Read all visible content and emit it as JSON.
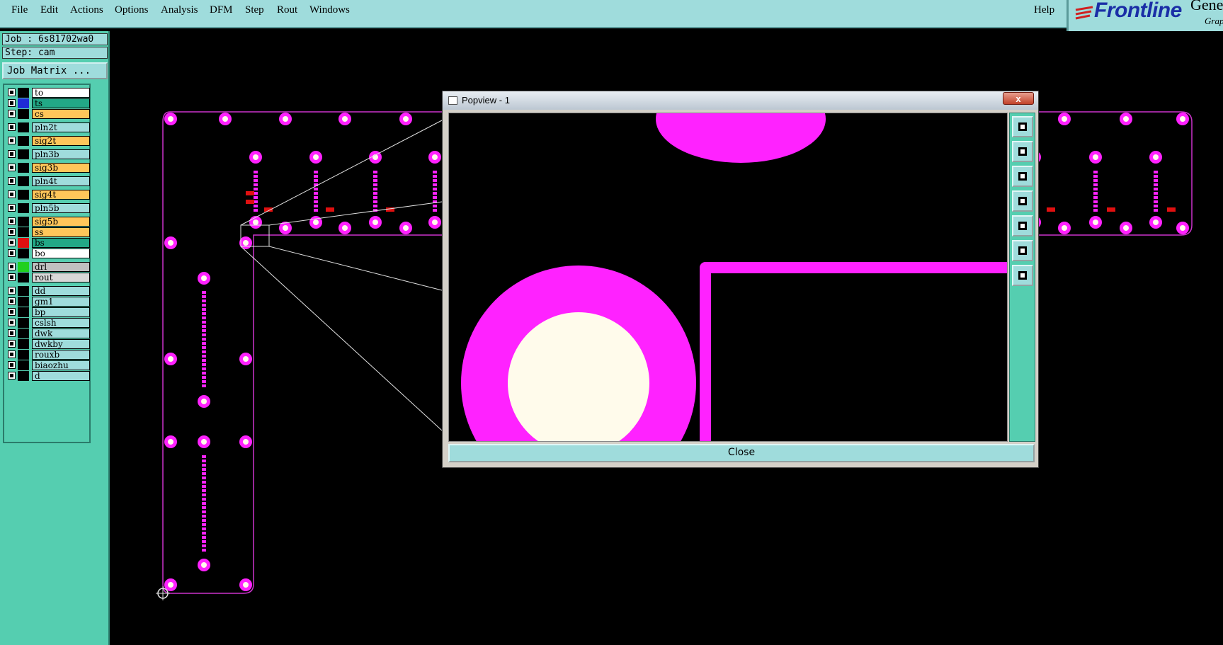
{
  "menu": {
    "items": [
      "File",
      "Edit",
      "Actions",
      "Options",
      "Analysis",
      "DFM",
      "Step",
      "Rout",
      "Windows"
    ],
    "help": "Help"
  },
  "brand": {
    "name": "Frontline",
    "product_fragment": "Gene",
    "sub_fragment": "Grap"
  },
  "job": {
    "job_label": "Job : 6s81702wa0",
    "step_label": "Step: cam",
    "matrix_button": "Job Matrix ..."
  },
  "layers": [
    {
      "name": "to",
      "color": "#000000",
      "name_bg": "#ffffff"
    },
    {
      "name": "ts",
      "color": "#1f2bd6",
      "name_bg": "#22a886"
    },
    {
      "name": "cs",
      "color": "#000000",
      "name_bg": "#ffc65a"
    },
    {
      "name": "pln2t",
      "color": "#000000",
      "name_bg": "#9fdcdc"
    },
    {
      "name": "sig2t",
      "color": "#000000",
      "name_bg": "#ffc65a"
    },
    {
      "name": "pln3b",
      "color": "#000000",
      "name_bg": "#9fdcdc"
    },
    {
      "name": "sig3b",
      "color": "#000000",
      "name_bg": "#ffc65a"
    },
    {
      "name": "pln4t",
      "color": "#000000",
      "name_bg": "#9fdcdc"
    },
    {
      "name": "sig4t",
      "color": "#000000",
      "name_bg": "#ffc65a"
    },
    {
      "name": "pln5b",
      "color": "#000000",
      "name_bg": "#9fdcdc"
    },
    {
      "name": "sig5b",
      "color": "#000000",
      "name_bg": "#ffc65a"
    },
    {
      "name": "ss",
      "color": "#000000",
      "name_bg": "#ffc65a"
    },
    {
      "name": "bs",
      "color": "#e01010",
      "name_bg": "#22a886"
    },
    {
      "name": "bo",
      "color": "#000000",
      "name_bg": "#ffffff"
    },
    {
      "name": "drl",
      "color": "#20d020",
      "name_bg": "#c0c0c0"
    },
    {
      "name": "rout",
      "color": "#000000",
      "name_bg": "#d8d8d8"
    },
    {
      "name": "dd",
      "color": "#000000",
      "name_bg": "#9fdcdc"
    },
    {
      "name": "gm1",
      "color": "#000000",
      "name_bg": "#9fdcdc"
    },
    {
      "name": "bp",
      "color": "#000000",
      "name_bg": "#9fdcdc"
    },
    {
      "name": "cslsh",
      "color": "#000000",
      "name_bg": "#9fdcdc"
    },
    {
      "name": "dwk",
      "color": "#000000",
      "name_bg": "#9fdcdc"
    },
    {
      "name": "dwkby",
      "color": "#000000",
      "name_bg": "#9fdcdc"
    },
    {
      "name": "rouxb",
      "color": "#000000",
      "name_bg": "#9fdcdc"
    },
    {
      "name": "biaozhu",
      "color": "#000000",
      "name_bg": "#9fdcdc"
    },
    {
      "name": "d",
      "color": "#000000",
      "name_bg": "#9fdcdc"
    }
  ],
  "popview": {
    "title": "Popview - 1",
    "close_x": "x",
    "close_button": "Close",
    "tools": [
      "zoom-fit-icon",
      "pan-up-icon",
      "pan-down-icon",
      "pan-left-icon",
      "pan-right-icon",
      "zoom-in-icon",
      "zoom-out-icon"
    ]
  },
  "colors": {
    "accent_teal": "#55ceb0",
    "panel_light": "#9fdcdc",
    "pad_magenta": "#ff22ff",
    "drill_ivory": "#fffbeb",
    "board_outline": "#cc33cc"
  }
}
